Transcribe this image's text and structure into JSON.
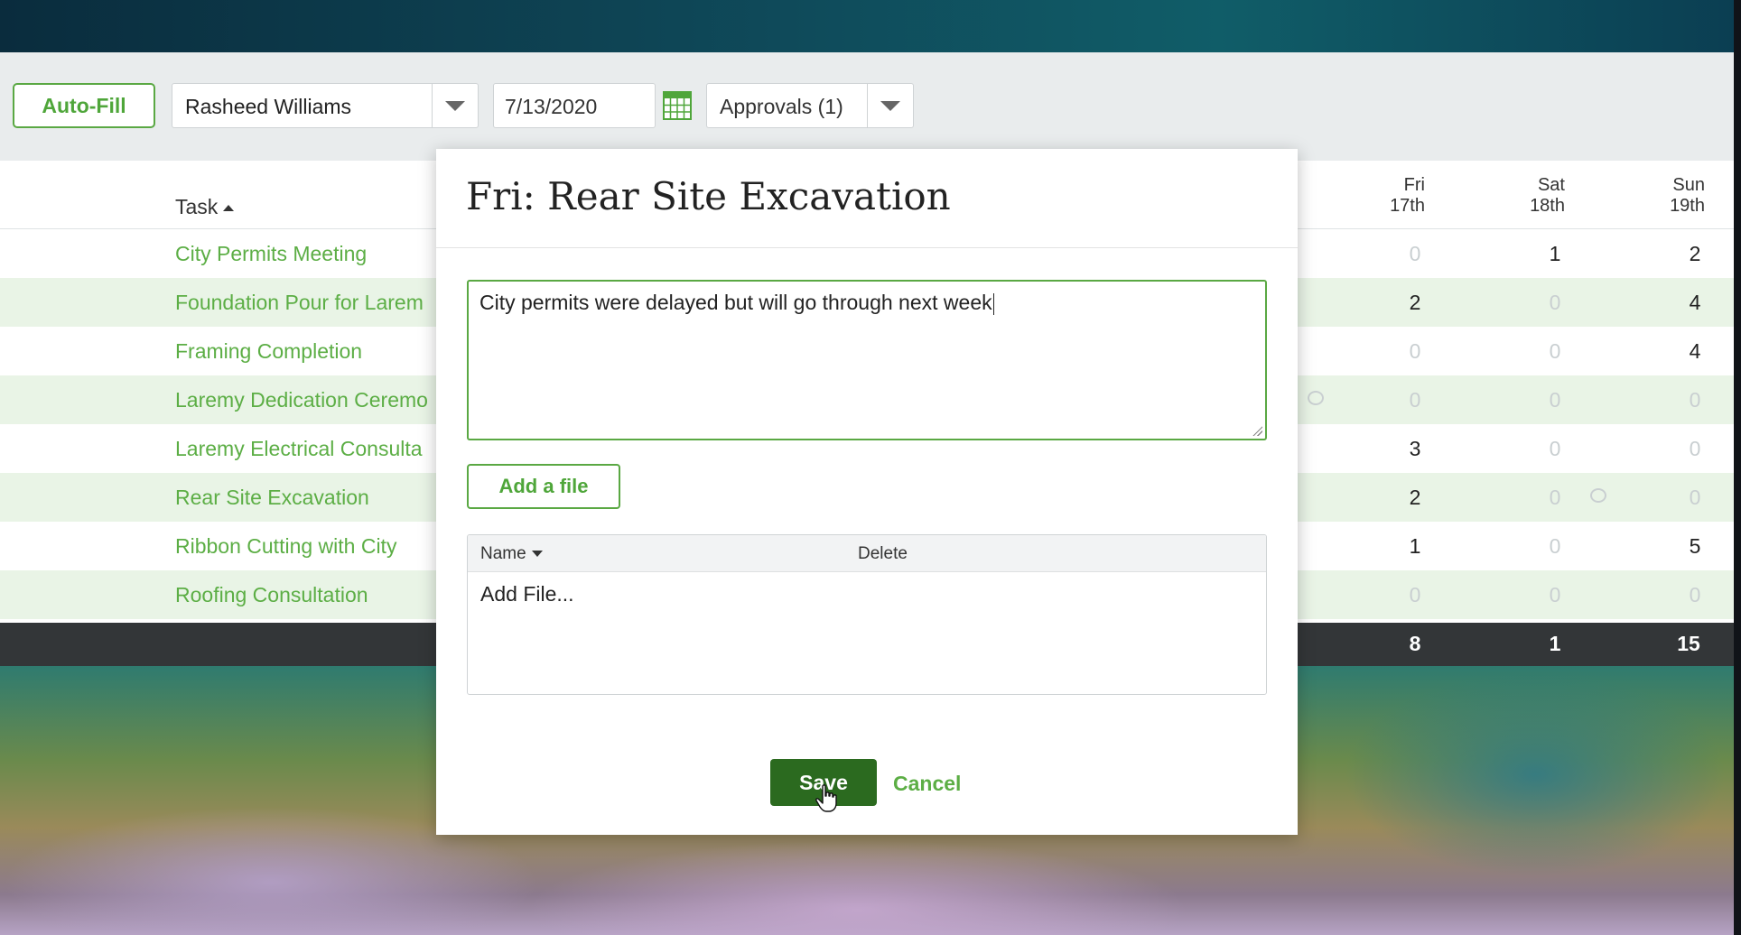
{
  "toolbar": {
    "autofill_label": "Auto-Fill",
    "employee": "Rasheed Williams",
    "date": "7/13/2020",
    "approvals": "Approvals (1)"
  },
  "grid": {
    "task_header": "Task",
    "days": [
      {
        "day": "Fri",
        "date": "17th"
      },
      {
        "day": "Sat",
        "date": "18th"
      },
      {
        "day": "Sun",
        "date": "19th"
      }
    ],
    "rows": [
      {
        "task": "City Permits Meeting",
        "fri": "0",
        "sat": "1",
        "sun": "2"
      },
      {
        "task": "Foundation Pour for Larem",
        "fri": "2",
        "sat": "0",
        "sun": "4"
      },
      {
        "task": "Framing Completion",
        "fri": "0",
        "sat": "0",
        "sun": "4"
      },
      {
        "task": "Laremy Dedication Ceremo",
        "fri": "0",
        "sat": "0",
        "sun": "0"
      },
      {
        "task": "Laremy Electrical Consulta",
        "fri": "3",
        "sat": "0",
        "sun": "0"
      },
      {
        "task": "Rear Site Excavation",
        "fri": "2",
        "sat": "0",
        "sun": "0"
      },
      {
        "task": "Ribbon Cutting with City",
        "fri": "1",
        "sat": "0",
        "sun": "5"
      },
      {
        "task": "Roofing Consultation",
        "fri": "0",
        "sat": "0",
        "sun": "0"
      }
    ],
    "totals": {
      "fri": "8",
      "sat": "1",
      "sun": "15"
    }
  },
  "modal": {
    "title": "Fri: Rear Site Excavation",
    "notes": "City permits were delayed but will go through next week",
    "add_file_label": "Add a file",
    "file_table": {
      "name_header": "Name",
      "delete_header": "Delete",
      "add_file_link": "Add File..."
    },
    "save_label": "Save",
    "cancel_label": "Cancel"
  },
  "colors": {
    "accent_green": "#5cae45",
    "save_green": "#2b6a1f",
    "row_alt": "#e9f4e6"
  }
}
